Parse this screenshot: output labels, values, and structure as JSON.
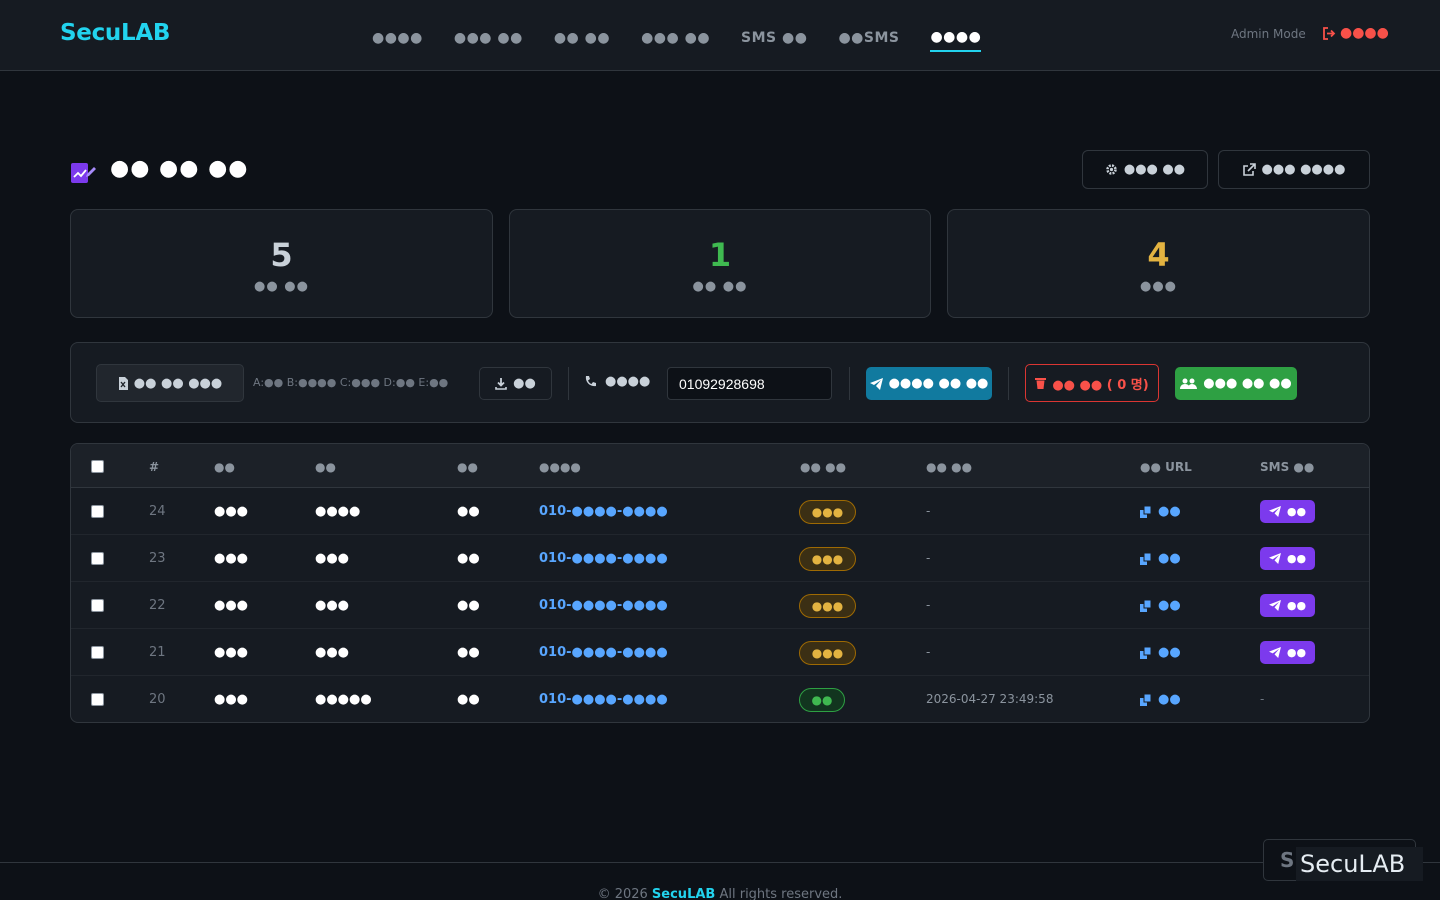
{
  "brand": "SecuLAB",
  "nav": [
    {
      "label": "●●●●",
      "active": false
    },
    {
      "label": "●●● ●●",
      "active": false
    },
    {
      "label": "●● ●●",
      "active": false
    },
    {
      "label": "●●● ●●",
      "active": false
    },
    {
      "label": "SMS ●●",
      "active": false
    },
    {
      "label": "●●SMS",
      "active": false
    },
    {
      "label": "●●●●",
      "active": true
    }
  ],
  "admin_mode": "Admin Mode",
  "logout_label": "●●●●",
  "page": {
    "title": "●● ●● ●●",
    "settings_button": "●●● ●●",
    "open_button": "●●● ●●●●"
  },
  "stats": [
    {
      "value": "5",
      "label": "●● ●●",
      "color": "#c9d1d9"
    },
    {
      "value": "1",
      "label": "●● ●●",
      "color": "#3fb950"
    },
    {
      "value": "4",
      "label": "●●●",
      "color": "#e3b341"
    }
  ],
  "toolbar": {
    "file_button": "●● ●● ●●●",
    "column_hint": "A:●● B:●●●● C:●●● D:●● E:●●",
    "download_button": "●●",
    "phone_label": "●●●●",
    "phone_value": "01092928698",
    "send_button": "●●●● ●● ●●",
    "delete_button": "●● ●● ( 0 명)",
    "group_button": "●●● ●● ●●"
  },
  "table": {
    "headers": {
      "id": "#",
      "name": "●●",
      "dept": "●●",
      "pos": "●●",
      "phone": "●●●●",
      "status": "●● ●●",
      "time": "●● ●●",
      "url": "●● URL",
      "sms": "SMS ●●"
    },
    "rows": [
      {
        "id": "24",
        "name": "●●●",
        "dept": "●●●●",
        "pos": "●●",
        "phone": "010-●●●●-●●●●",
        "status": "●●●",
        "status_type": "warn",
        "time": "-",
        "url": "●●",
        "sms": "●●",
        "has_sms": true
      },
      {
        "id": "23",
        "name": "●●●",
        "dept": "●●●",
        "pos": "●●",
        "phone": "010-●●●●-●●●●",
        "status": "●●●",
        "status_type": "warn",
        "time": "-",
        "url": "●●",
        "sms": "●●",
        "has_sms": true
      },
      {
        "id": "22",
        "name": "●●●",
        "dept": "●●●",
        "pos": "●●",
        "phone": "010-●●●●-●●●●",
        "status": "●●●",
        "status_type": "warn",
        "time": "-",
        "url": "●●",
        "sms": "●●",
        "has_sms": true
      },
      {
        "id": "21",
        "name": "●●●",
        "dept": "●●●",
        "pos": "●●",
        "phone": "010-●●●●-●●●●",
        "status": "●●●",
        "status_type": "warn",
        "time": "-",
        "url": "●●",
        "sms": "●●",
        "has_sms": true
      },
      {
        "id": "20",
        "name": "●●●",
        "dept": "●●●●●",
        "pos": "●●",
        "phone": "010-●●●●-●●●●",
        "status": "●●",
        "status_type": "ok",
        "time": "2026-04-27 23:49:58",
        "url": "●●",
        "sms": "-",
        "has_sms": false
      }
    ]
  },
  "footer": {
    "copyright": "© 2026",
    "brand": "SecuLAB",
    "rights": "All rights reserved."
  },
  "watermark": "SecuLAB"
}
